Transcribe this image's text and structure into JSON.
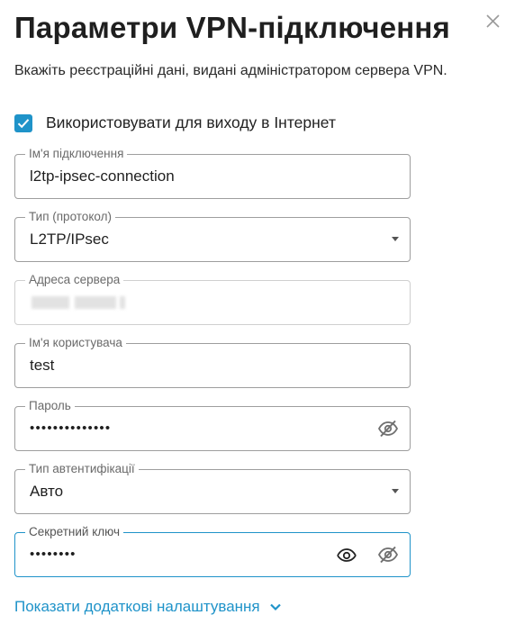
{
  "dialog": {
    "title": "Параметри VPN-підключення",
    "subtitle": "Вкажіть реєстраційні дані, видані адміністратором сервера VPN."
  },
  "internet_checkbox": {
    "label": "Використовувати для виходу в Інтернет",
    "checked": true
  },
  "fields": {
    "connection_name": {
      "label": "Ім'я підключення",
      "value": "l2tp-ipsec-connection"
    },
    "protocol": {
      "label": "Тип (протокол)",
      "value": "L2TP/IPsec"
    },
    "server_address": {
      "label": "Адреса сервера"
    },
    "username": {
      "label": "Ім'я користувача",
      "value": "test"
    },
    "password": {
      "label": "Пароль",
      "value": "••••••••••••••"
    },
    "auth_type": {
      "label": "Тип автентифікації",
      "value": "Авто"
    },
    "secret_key": {
      "label": "Секретний ключ",
      "value": "••••••••"
    }
  },
  "more_settings": {
    "label": "Показати додаткові налаштування"
  },
  "colors": {
    "accent": "#1f93c9",
    "text": "#1f1f1f",
    "border": "#9e9e9e"
  },
  "icons": {
    "close": "close-icon",
    "check": "checkmark-icon",
    "dropdown": "caret-down-icon",
    "eye": "eye-icon",
    "eye_off": "eye-off-icon",
    "chevron": "chevron-down-icon"
  }
}
